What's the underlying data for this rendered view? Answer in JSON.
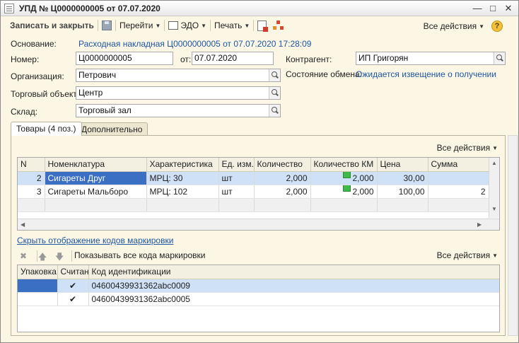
{
  "window": {
    "title": "УПД № Ц0000000005 от 07.07.2020"
  },
  "toolbar": {
    "save_close": "Записать и закрыть",
    "goto": "Перейти",
    "edo": "ЭДО",
    "print": "Печать",
    "all_actions": "Все действия"
  },
  "form": {
    "basis_label": "Основание:",
    "basis_value": "Расходная накладная Ц0000000005 от 07.07.2020 17:28:09",
    "number_label": "Номер:",
    "number_value": "Ц0000000005",
    "from_label": "от:",
    "date_value": "07.07.2020",
    "counterparty_label": "Контрагент:",
    "counterparty_value": "ИП Григорян",
    "org_label": "Организация:",
    "org_value": "Петрович",
    "exchange_label": "Состояние обмена:",
    "exchange_value": "Ожидается извещение о получении",
    "trade_label": "Торговый объект:",
    "trade_value": "Центр",
    "warehouse_label": "Склад:",
    "warehouse_value": "Торговый зал"
  },
  "tabs": [
    "Товары (4 поз.)",
    "Дополнительно"
  ],
  "goods": {
    "all_actions": "Все действия",
    "columns": [
      "N",
      "Номенклатура",
      "Характеристика",
      "Ед. изм.",
      "Количество",
      "Количество КМ",
      "Цена",
      "Сумма"
    ],
    "rows": [
      {
        "n": "2",
        "name": "Сигареты Друг",
        "char": "МРЦ: 30",
        "unit": "шт",
        "qty": "2,000",
        "qty_km": "2,000",
        "price": "30,00",
        "sum": ""
      },
      {
        "n": "3",
        "name": "Сигареты Мальборо",
        "char": "МРЦ: 102",
        "unit": "шт",
        "qty": "2,000",
        "qty_km": "2,000",
        "price": "100,00",
        "sum": "2"
      }
    ]
  },
  "marking": {
    "hide_link": "Скрыть отображение кодов маркировки",
    "show_all": "Показывать все кода маркировки",
    "all_actions": "Все действия",
    "columns": [
      "Упаковка",
      "Считан",
      "Код идентификации"
    ],
    "rows": [
      {
        "pack": "",
        "read": "✔",
        "code": "04600439931362abc0009"
      },
      {
        "pack": "",
        "read": "✔",
        "code": "04600439931362abc0005"
      }
    ]
  }
}
